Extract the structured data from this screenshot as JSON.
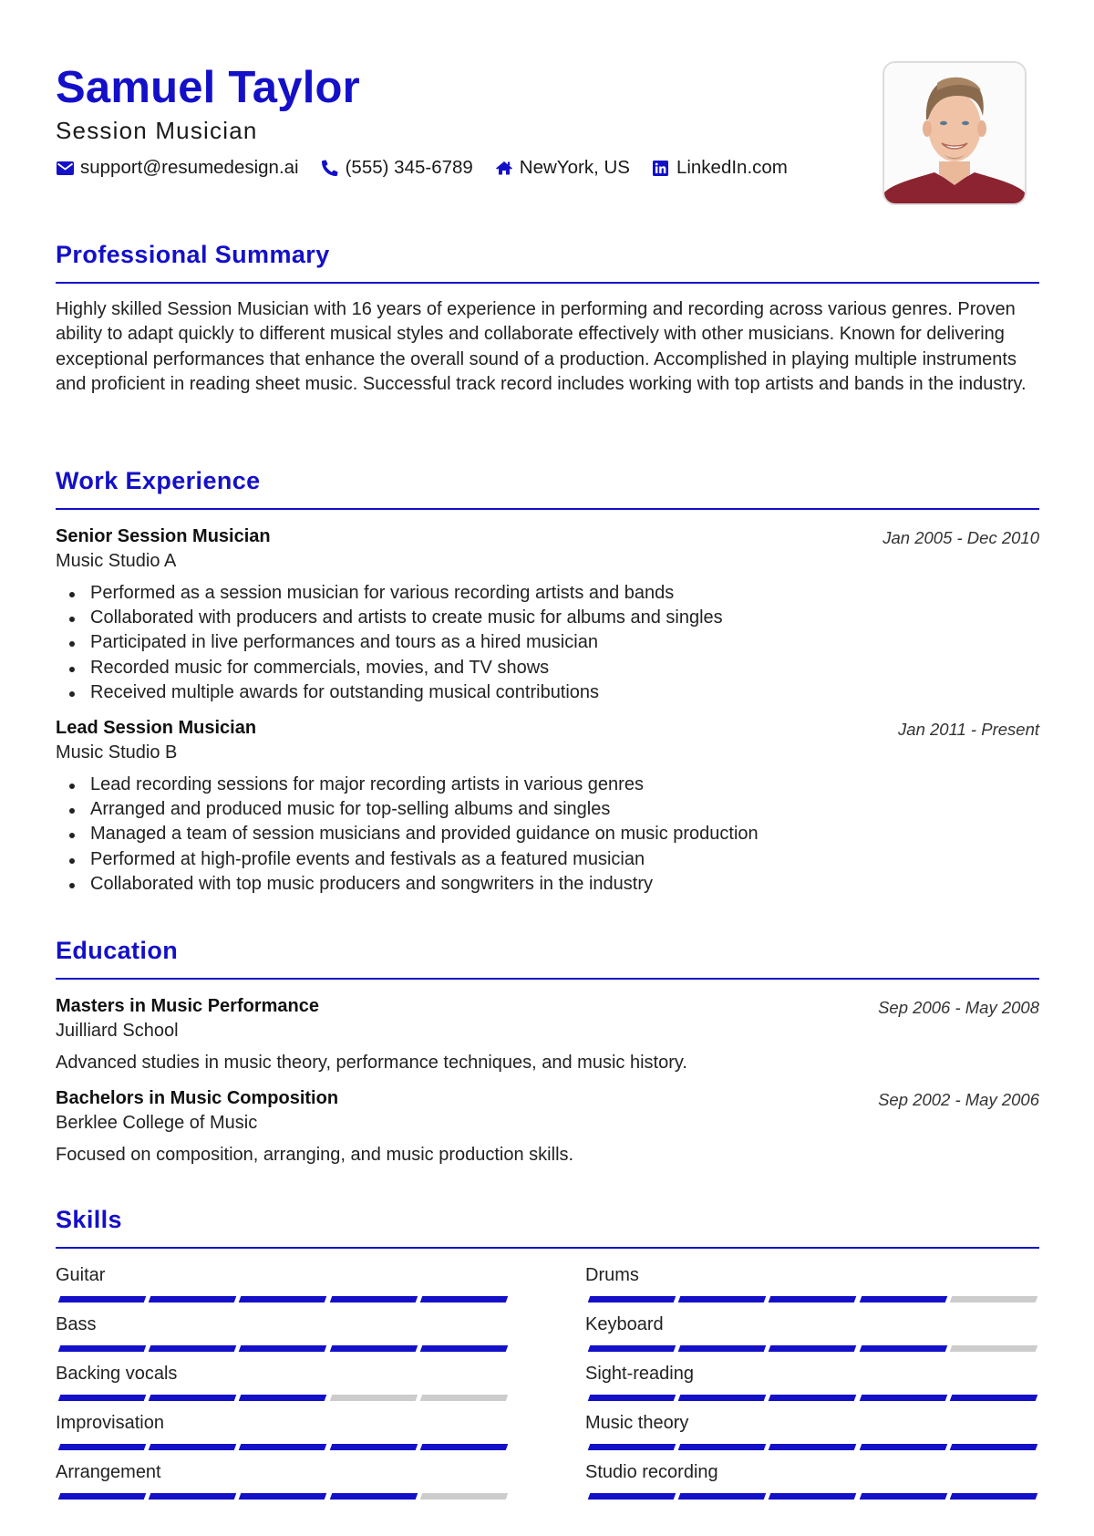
{
  "header": {
    "name": "Samuel Taylor",
    "role": "Session Musician",
    "photo_alt": "Profile photo",
    "contacts": [
      {
        "icon": "envelope-icon",
        "text": "support@resumedesign.ai"
      },
      {
        "icon": "phone-icon",
        "text": "(555) 345-6789"
      },
      {
        "icon": "home-icon",
        "text": "NewYork, US"
      },
      {
        "icon": "linkedin-icon",
        "text": "LinkedIn.com"
      }
    ]
  },
  "colors": {
    "accent": "#1410c8",
    "text": "#1a1a1a",
    "skill_empty": "#cccccc"
  },
  "summary": {
    "title": "Professional Summary",
    "text": "Highly skilled Session Musician with 16 years of experience in performing and recording across various genres. Proven ability to adapt quickly to different musical styles and collaborate effectively with other musicians. Known for delivering exceptional performances that enhance the overall sound of a production. Accomplished in playing multiple instruments and proficient in reading sheet music. Successful track record includes working with top artists and bands in the industry."
  },
  "experience": {
    "title": "Work Experience",
    "items": [
      {
        "title": "Senior Session Musician",
        "org": "Music Studio A",
        "date": "Jan 2005 - Dec 2010",
        "bullets": [
          "Performed as a session musician for various recording artists and bands",
          "Collaborated with producers and artists to create music for albums and singles",
          "Participated in live performances and tours as a hired musician",
          "Recorded music for commercials, movies, and TV shows",
          "Received multiple awards for outstanding musical contributions"
        ]
      },
      {
        "title": "Lead Session Musician",
        "org": "Music Studio B",
        "date": "Jan 2011 - Present",
        "bullets": [
          "Lead recording sessions for major recording artists in various genres",
          "Arranged and produced music for top-selling albums and singles",
          "Managed a team of session musicians and provided guidance on music production",
          "Performed at high-profile events and festivals as a featured musician",
          "Collaborated with top music producers and songwriters in the industry"
        ]
      }
    ]
  },
  "education": {
    "title": "Education",
    "items": [
      {
        "title": "Masters in Music Performance",
        "org": "Juilliard School",
        "date": "Sep 2006 - May 2008",
        "desc": "Advanced studies in music theory, performance techniques, and music history."
      },
      {
        "title": "Bachelors in Music Composition",
        "org": "Berklee College of Music",
        "date": "Sep 2002 - May 2006",
        "desc": "Focused on composition, arranging, and music production skills."
      }
    ]
  },
  "skills": {
    "title": "Skills",
    "max_level": 5,
    "items": [
      {
        "name": "Guitar",
        "level": 5
      },
      {
        "name": "Drums",
        "level": 4
      },
      {
        "name": "Bass",
        "level": 5
      },
      {
        "name": "Keyboard",
        "level": 4
      },
      {
        "name": "Backing vocals",
        "level": 3
      },
      {
        "name": "Sight-reading",
        "level": 5
      },
      {
        "name": "Improvisation",
        "level": 5
      },
      {
        "name": "Music theory",
        "level": 5
      },
      {
        "name": "Arrangement",
        "level": 4
      },
      {
        "name": "Studio recording",
        "level": 5
      }
    ]
  }
}
